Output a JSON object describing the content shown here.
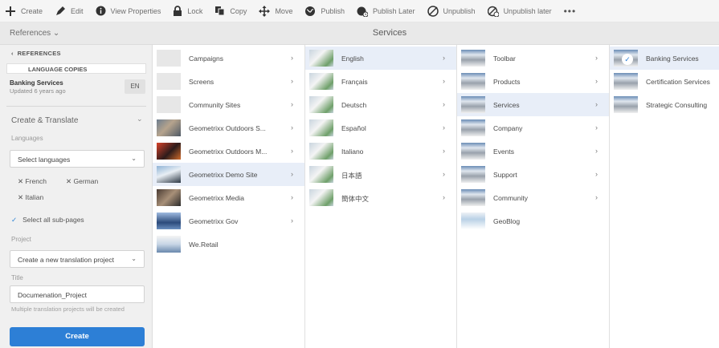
{
  "toolbar": {
    "create": "Create",
    "edit": "Edit",
    "view_properties": "View Properties",
    "lock": "Lock",
    "copy": "Copy",
    "move": "Move",
    "publish": "Publish",
    "publish_later": "Publish Later",
    "unpublish": "Unpublish",
    "unpublish_later": "Unpublish later",
    "more": "•••"
  },
  "header": {
    "references": "References",
    "title": "Services"
  },
  "rail": {
    "back": "REFERENCES",
    "language_copies": "LANGUAGE COPIES",
    "item_name": "Banking Services",
    "item_updated": "Updated 6 years ago",
    "item_lang": "EN",
    "section_title": "Create & Translate",
    "languages_label": "Languages",
    "languages_placeholder": "Select languages",
    "tags": [
      "French",
      "German",
      "Italian"
    ],
    "select_subpages": "Select all sub-pages",
    "project_label": "Project",
    "project_value": "Create a new translation project",
    "title_label": "Title",
    "title_value": "Documenation_Project",
    "note": "Multiple translation projects will be created",
    "create_button": "Create"
  },
  "columns": [
    {
      "items": [
        {
          "name": "Campaigns",
          "thumb": "folder-icon",
          "chevron": true,
          "selected": false
        },
        {
          "name": "Screens",
          "thumb": "folder-icon",
          "chevron": true,
          "selected": false
        },
        {
          "name": "Community Sites",
          "thumb": "folder-icon",
          "chevron": true,
          "selected": false
        },
        {
          "name": "Geometrixx Outdoors S...",
          "thumb": "site-thumbnail",
          "chevron": true,
          "selected": false
        },
        {
          "name": "Geometrixx Outdoors M...",
          "thumb": "site-thumbnail",
          "chevron": true,
          "selected": false
        },
        {
          "name": "Geometrixx Demo Site",
          "thumb": "site-thumbnail",
          "chevron": true,
          "selected": true
        },
        {
          "name": "Geometrixx Media",
          "thumb": "site-thumbnail",
          "chevron": true,
          "selected": false
        },
        {
          "name": "Geometrixx Gov",
          "thumb": "site-thumbnail",
          "chevron": true,
          "selected": false
        },
        {
          "name": "We.Retail",
          "thumb": "site-thumbnail",
          "chevron": false,
          "selected": false
        }
      ]
    },
    {
      "items": [
        {
          "name": "English",
          "chevron": true,
          "selected": true
        },
        {
          "name": "Français",
          "chevron": true,
          "selected": false
        },
        {
          "name": "Deutsch",
          "chevron": true,
          "selected": false
        },
        {
          "name": "Español",
          "chevron": true,
          "selected": false
        },
        {
          "name": "Italiano",
          "chevron": true,
          "selected": false
        },
        {
          "name": "日本語",
          "chevron": true,
          "selected": false
        },
        {
          "name": "簡体中文",
          "chevron": true,
          "selected": false
        }
      ]
    },
    {
      "items": [
        {
          "name": "Toolbar",
          "chevron": true,
          "selected": false
        },
        {
          "name": "Products",
          "chevron": true,
          "selected": false
        },
        {
          "name": "Services",
          "chevron": true,
          "selected": true
        },
        {
          "name": "Company",
          "chevron": true,
          "selected": false
        },
        {
          "name": "Events",
          "chevron": true,
          "selected": false
        },
        {
          "name": "Support",
          "chevron": true,
          "selected": false
        },
        {
          "name": "Community",
          "chevron": true,
          "selected": false
        },
        {
          "name": "GeoBlog",
          "chevron": false,
          "selected": false
        }
      ]
    },
    {
      "items": [
        {
          "name": "Banking Services",
          "chevron": false,
          "selected": true,
          "checked": true
        },
        {
          "name": "Certification Services",
          "chevron": false,
          "selected": false
        },
        {
          "name": "Strategic Consulting",
          "chevron": false,
          "selected": false
        }
      ]
    }
  ],
  "colors": {
    "accent": "#2d7fd6",
    "selected_row": "#e8eef8",
    "rail_bg": "#f0f0f0"
  }
}
